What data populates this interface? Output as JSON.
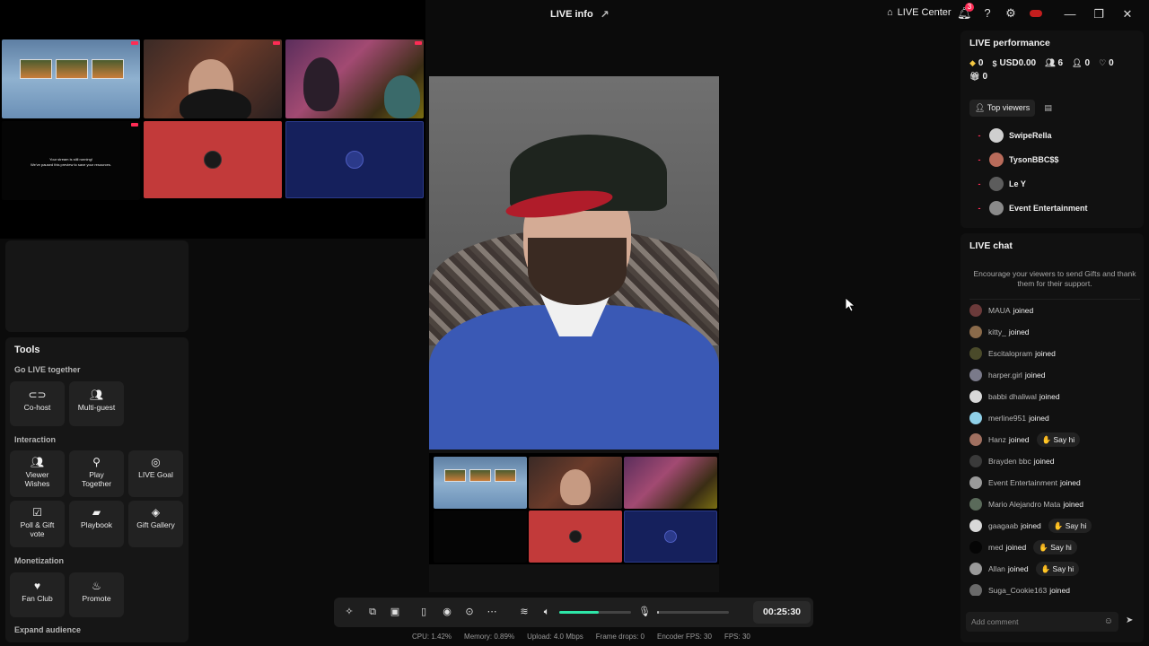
{
  "titlebar": {
    "title": "LIVE info",
    "live_center": "LIVE Center",
    "notification_count": "3"
  },
  "mini_window": {
    "stream_notice_line1": "Your stream is still running!",
    "stream_notice_line2": "We've paused this preview to save your resources."
  },
  "tools": {
    "title": "Tools",
    "sections": {
      "go_live_together": "Go LIVE together",
      "interaction": "Interaction",
      "monetization": "Monetization",
      "expand_audience": "Expand audience"
    },
    "items": {
      "cohost": "Co-host",
      "multiguest": "Multi-guest",
      "viewer_wishes": "Viewer Wishes",
      "play_together": "Play Together",
      "live_goal": "LIVE Goal",
      "poll_gift_vote": "Poll & Gift vote",
      "playbook": "Playbook",
      "gift_gallery": "Gift Gallery",
      "fan_club": "Fan Club",
      "promote": "Promote"
    }
  },
  "controls": {
    "timer": "00:25:30",
    "volume_level": 0.55,
    "mic_level": 0.02
  },
  "stats": {
    "cpu": "CPU: 1.42%",
    "memory": "Memory: 0.89%",
    "upload": "Upload: 4.0 Mbps",
    "frame_drops": "Frame drops: 0",
    "encoder_fps": "Encoder FPS: 30",
    "fps": "FPS: 30"
  },
  "performance": {
    "title": "LIVE performance",
    "diamonds": "0",
    "earnings": "USD0.00",
    "viewers": "6",
    "new_followers": "0",
    "likes": "0",
    "gifts": "0",
    "top_viewers_tab": "Top viewers",
    "top_viewers": [
      {
        "rank": "-",
        "name": "SwipeRella",
        "color": "#cfcfcf"
      },
      {
        "rank": "-",
        "name": "TysonBBC$$",
        "color": "#b86b5a"
      },
      {
        "rank": "-",
        "name": "Le Y",
        "color": "#5c5c5c"
      },
      {
        "rank": "-",
        "name": "Event Entertainment",
        "color": "#8a8a8a"
      }
    ]
  },
  "chat": {
    "title": "LIVE chat",
    "banner": "Encourage your viewers to send Gifts and thank them for their support.",
    "say_hi": "Say hi",
    "joined_word": "joined",
    "input_placeholder": "Add comment",
    "messages": [
      {
        "name": "MAUA",
        "color": "#6b3a3a",
        "say_hi": false
      },
      {
        "name": "kitty_",
        "color": "#8a6a4a",
        "say_hi": false
      },
      {
        "name": "Escitalopram",
        "color": "#4a4a2a",
        "say_hi": false
      },
      {
        "name": "harper.girl",
        "color": "#7a7a8a",
        "say_hi": false
      },
      {
        "name": "babbi dhaliwal",
        "color": "#d8d8d8",
        "say_hi": false
      },
      {
        "name": "merline951",
        "color": "#8fd0e8",
        "say_hi": false
      },
      {
        "name": "Hanz",
        "color": "#a07060",
        "say_hi": true
      },
      {
        "name": "Brayden bbc",
        "color": "#3a3a3a",
        "say_hi": false
      },
      {
        "name": "Event Entertainment",
        "color": "#9a9a9a",
        "say_hi": false
      },
      {
        "name": "Mario Alejandro Mata",
        "color": "#5a6a5a",
        "say_hi": false
      },
      {
        "name": "gaagaab",
        "color": "#d8d8d8",
        "say_hi": true
      },
      {
        "name": "med",
        "color": "#050505",
        "say_hi": true
      },
      {
        "name": "Allan",
        "color": "#9a9a9a",
        "say_hi": true
      },
      {
        "name": "Suga_Cookie163",
        "color": "#6a6a6a",
        "say_hi": false
      }
    ]
  }
}
